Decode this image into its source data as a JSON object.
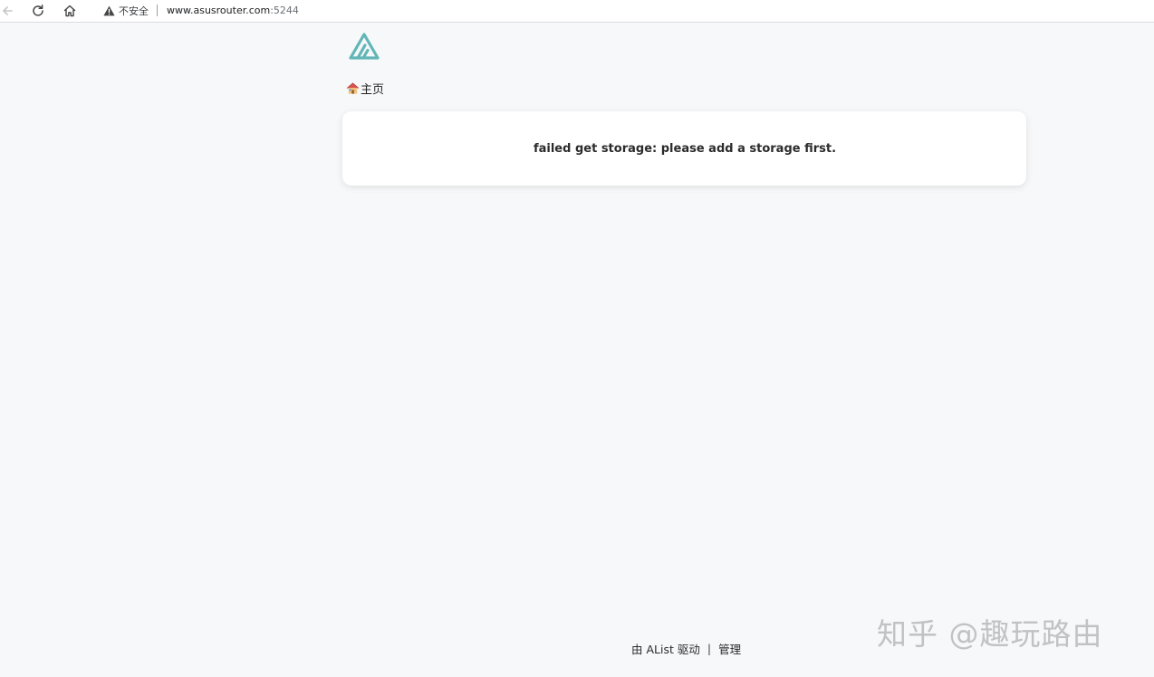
{
  "browser": {
    "security_label": "不安全",
    "url_host": "www.asusrouter.com",
    "url_port": ":5244"
  },
  "breadcrumb": {
    "home_label": "主页"
  },
  "card": {
    "message": "failed get storage: please add a storage first."
  },
  "footer": {
    "powered_by": "由 AList 驱动",
    "separator": "|",
    "admin_label": "管理"
  },
  "watermark": {
    "text": "知乎 @趣玩路由"
  },
  "colors": {
    "page_background": "#f7f8fa",
    "logo_teal": "#62b6b7"
  },
  "icons": [
    "back-arrow-icon",
    "reload-icon",
    "home-icon",
    "warning-icon",
    "alist-logo-icon",
    "house-emoji-icon"
  ]
}
